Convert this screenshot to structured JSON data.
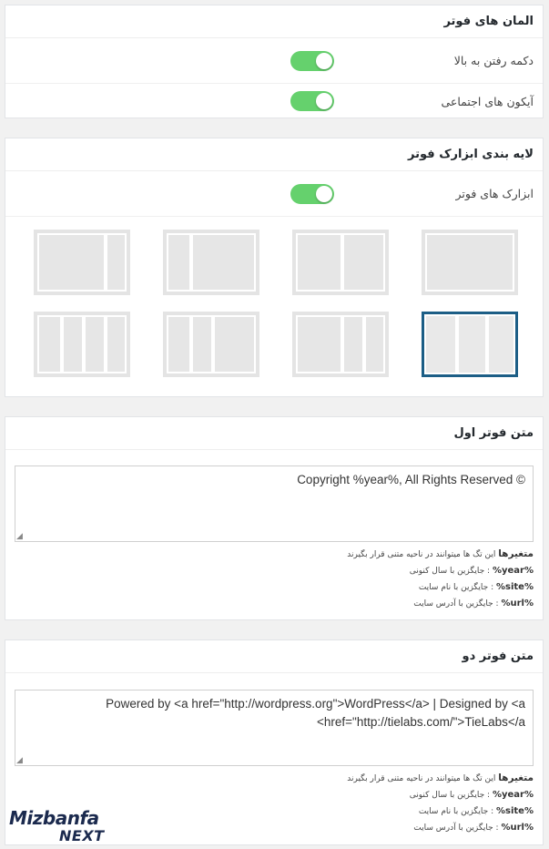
{
  "footer_elements": {
    "title": "المان های فوتر",
    "rows": [
      {
        "label": "دکمه رفتن به بالا",
        "on": true
      },
      {
        "label": "آیکون های اجتماعی",
        "on": true
      }
    ]
  },
  "footer_widgets": {
    "title": "لایه بندی ابزارک فوتر",
    "toggle_label": "ابزارک های فوتر",
    "toggle_on": true,
    "selected_layout": "3-columns"
  },
  "footer_text_1": {
    "title": "متن فوتر اول",
    "value": "© Copyright %year%, All Rights Reserved",
    "vars_title": "متغیرها",
    "vars_desc": "این تگ ها میتوانند در ناحیه متنی قرار بگیرند",
    "vars": [
      {
        "key": "%year%",
        "desc": ": جایگزین با سال کنونی"
      },
      {
        "key": "%site%",
        "desc": ": جایگزین با نام سایت"
      },
      {
        "key": "%url%",
        "desc": ": جایگزین با آدرس سایت"
      }
    ]
  },
  "footer_text_2": {
    "title": "متن فوتر دو",
    "value": "Powered by <a href=\"http://wordpress.org\">WordPress</a> | Designed by <a href=\"http://tielabs.com/\">TieLabs</a>",
    "vars_title": "متغیرها",
    "vars_desc": "این تگ ها میتوانند در ناحیه متنی قرار بگیرند",
    "vars": [
      {
        "key": "%year%",
        "desc": ": جایگزین با سال کنونی"
      },
      {
        "key": "%site%",
        "desc": ": جایگزین با نام سایت"
      },
      {
        "key": "%url%",
        "desc": ": جایگزین با آدرس سایت"
      }
    ]
  },
  "logo": {
    "top": "Mizbanfa",
    "bottom": "NEXT"
  },
  "colors": {
    "toggle_on": "#65d16d",
    "selected_border": "#1c5e86",
    "logo_dark": "#1b2a4e",
    "logo_accent": "#3a8fd0"
  }
}
